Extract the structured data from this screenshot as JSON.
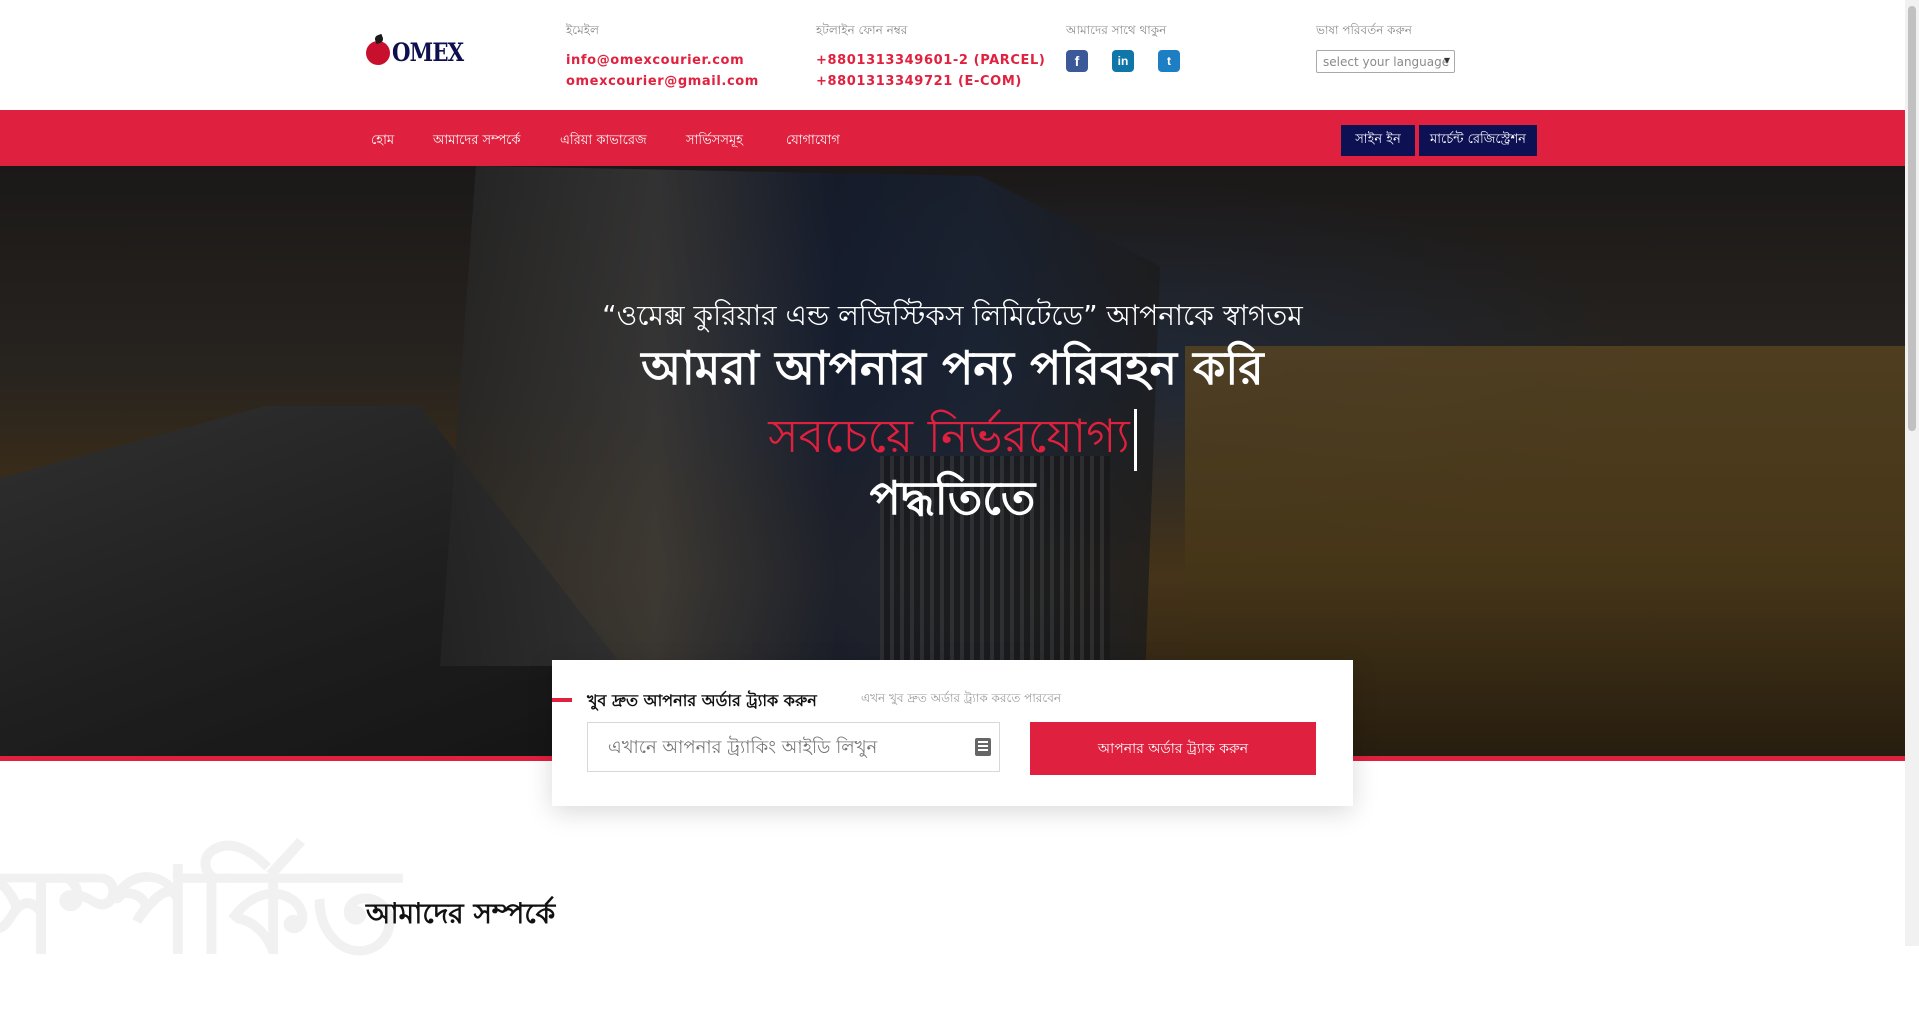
{
  "logo": {
    "text": "OMEX"
  },
  "header": {
    "email": {
      "label": "ইমেইল",
      "lines": [
        "info@omexcourier.com",
        "omexcourier@gmail.com"
      ]
    },
    "phone": {
      "label": "হটলাইন ফোন নম্বর",
      "lines": [
        "+8801313349601-2 (PARCEL)",
        "+8801313349721 (E-COM)"
      ]
    },
    "social": {
      "label": "আমাদের সাথে থাকুন",
      "icons": [
        "facebook-icon",
        "linkedin-icon",
        "twitter-icon"
      ]
    },
    "language": {
      "label": "ভাষা পরিবর্তন করুন",
      "selected": "select your language"
    }
  },
  "nav": {
    "items": [
      "হোম",
      "আমাদের সম্পর্কে",
      "এরিয়া কাভারেজ",
      "সার্ভিসসমূহ",
      "যোগাযোগ"
    ],
    "signin": "সাইন ইন",
    "merchant_register": "মার্চেন্ট রেজিস্ট্রেশন"
  },
  "hero": {
    "welcome": "“ওমেক্স কুরিয়ার এন্ড লজিস্টিকস লিমিটেডে” আপনাকে স্বাগতম",
    "line1": "আমরা আপনার পন্য পরিবহন করি",
    "line2": "সবচেয়ে নির্ভরযোগ্য",
    "line3": "পদ্ধতিতে"
  },
  "tracking": {
    "title": "খুব দ্রুত আপনার অর্ডার ট্র্যাক করুন",
    "subtitle": "এখন খুব দ্রুত অর্ডার ট্র্যাক করতে পারবেন",
    "placeholder": "এখানে আপনার ট্র্যাকিং আইডি লিখুন",
    "button": "আপনার অর্ডার ট্র্যাক করুন"
  },
  "about": {
    "watermark": "সম্পর্কিত",
    "title": "আমাদের সম্পর্কে"
  },
  "colors": {
    "accent": "#e0203f",
    "navy": "#0d1154"
  }
}
